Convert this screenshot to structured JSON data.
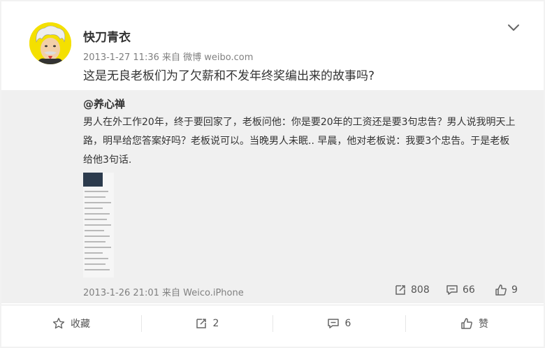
{
  "post": {
    "author": "快刀青衣",
    "meta": "2013-1-27 11:36 来自 微博 weibo.com",
    "text": "这是无良老板们为了欠薪和不发年终奖编出来的故事吗?",
    "avatar_color": "#f4e000"
  },
  "repost": {
    "user": "@养心禅",
    "text": "男人在外工作20年，终于要回家了，老板问他：你是要20年的工资还是要3句忠告？男人说我明天上路，明早给您答案好吗？老板说可以。当晚男人未眠.. 早晨，他对老板说：我要3个忠告。于是老板给他3句话.",
    "footer": "2013-1-26 21:01 来自 Weico.iPhone",
    "stats": {
      "reposts": "808",
      "comments": "66",
      "likes": "9"
    }
  },
  "actions": {
    "favorite": "收藏",
    "repost": "2",
    "comment": "6",
    "like": "赞"
  },
  "colors": {
    "repost_bg": "#f0f0f0",
    "meta_gray": "#808080"
  }
}
